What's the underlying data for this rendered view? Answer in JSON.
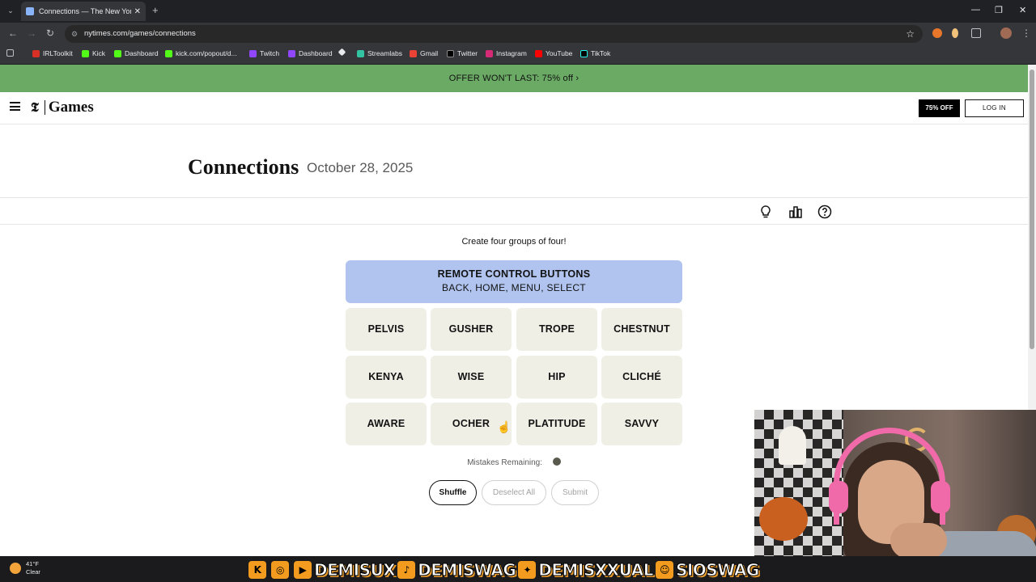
{
  "browser": {
    "tab_title": "Connections — The New York T",
    "url": "nytimes.com/games/connections",
    "bookmarks": [
      "IRLToolkit",
      "Kick",
      "Dashboard",
      "kick.com/popout/d...",
      "Twitch",
      "Dashboard",
      "Streamlabs",
      "Gmail",
      "Twitter",
      "Instagram",
      "YouTube",
      "TikTok"
    ]
  },
  "offer": {
    "text": "OFFER WON'T LAST:  75% off ›"
  },
  "header": {
    "brand": "Games",
    "promo_button": "75% OFF",
    "login_button": "LOG IN"
  },
  "page": {
    "title": "Connections",
    "date": "October 28, 2025"
  },
  "game": {
    "instructions": "Create four groups of four!",
    "solved_group": {
      "title": "REMOTE CONTROL BUTTONS",
      "words": "BACK, HOME, MENU, SELECT",
      "color": "#b0c4ef"
    },
    "cards": [
      "PELVIS",
      "GUSHER",
      "TROPE",
      "CHESTNUT",
      "KENYA",
      "WISE",
      "HIP",
      "CLICHÉ",
      "AWARE",
      "OCHER",
      "PLATITUDE",
      "SAVVY"
    ],
    "mistakes_label": "Mistakes Remaining:",
    "mistakes_remaining": 1,
    "buttons": {
      "shuffle": "Shuffle",
      "deselect": "Deselect All",
      "submit": "Submit"
    }
  },
  "taskbar": {
    "temp": "41°F",
    "condition": "Clear"
  },
  "overlay": {
    "handles": [
      "DEMISUX",
      "DEMISWAG",
      "DEMISXXUAL",
      "SIOSWAG"
    ]
  }
}
